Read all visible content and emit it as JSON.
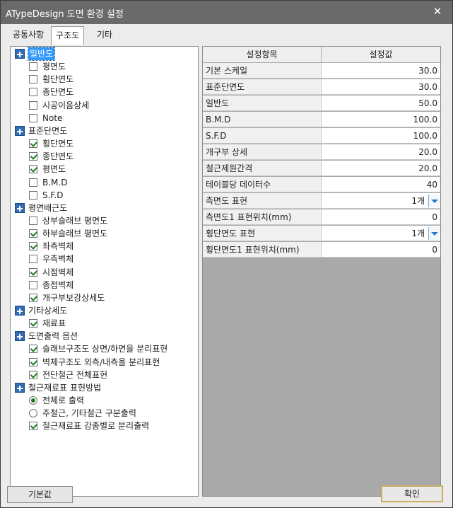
{
  "window": {
    "title": "ATypeDesign 도면 환경 설정",
    "close_label": "✕"
  },
  "tabs": [
    "공통사항",
    "구조도",
    "기타"
  ],
  "tree": [
    {
      "type": "group",
      "label": "일반도",
      "selected": true
    },
    {
      "type": "check",
      "label": "평면도",
      "checked": false
    },
    {
      "type": "check",
      "label": "횡단면도",
      "checked": false
    },
    {
      "type": "check",
      "label": "종단면도",
      "checked": false
    },
    {
      "type": "check",
      "label": "시공이음상세",
      "checked": false
    },
    {
      "type": "check",
      "label": "Note",
      "checked": false
    },
    {
      "type": "group",
      "label": "표준단면도"
    },
    {
      "type": "check",
      "label": "횡단면도",
      "checked": true
    },
    {
      "type": "check",
      "label": "종단면도",
      "checked": true
    },
    {
      "type": "check",
      "label": "평면도",
      "checked": true
    },
    {
      "type": "check",
      "label": "B.M.D",
      "checked": false
    },
    {
      "type": "check",
      "label": "S.F.D",
      "checked": false
    },
    {
      "type": "group",
      "label": "평면배근도"
    },
    {
      "type": "check",
      "label": "상부슬래브 평면도",
      "checked": false
    },
    {
      "type": "check",
      "label": "하부슬래브 평면도",
      "checked": true
    },
    {
      "type": "check",
      "label": "좌측벽체",
      "checked": true
    },
    {
      "type": "check",
      "label": "우측벽체",
      "checked": false
    },
    {
      "type": "check",
      "label": "시점벽체",
      "checked": true
    },
    {
      "type": "check",
      "label": "종점벽체",
      "checked": false
    },
    {
      "type": "check",
      "label": "개구부보강상세도",
      "checked": true
    },
    {
      "type": "group",
      "label": "기타상세도"
    },
    {
      "type": "check",
      "label": "재료표",
      "checked": true
    },
    {
      "type": "group",
      "label": "도면출력 옵션"
    },
    {
      "type": "check",
      "label": "슬래브구조도 상면/하면을 분리표현",
      "checked": true
    },
    {
      "type": "check",
      "label": "벽체구조도 외측/내측을 분리표현",
      "checked": true
    },
    {
      "type": "check",
      "label": "전단철근 전체표현",
      "checked": true
    },
    {
      "type": "group",
      "label": "철근재료표 표현방법"
    },
    {
      "type": "radio",
      "label": "전체로 출력",
      "checked": true
    },
    {
      "type": "radio",
      "label": "주철근, 기타철근 구분출력",
      "checked": false
    },
    {
      "type": "check",
      "label": "철근재료표 강종별로 분리출력",
      "checked": true
    }
  ],
  "grid": {
    "header_name": "설정항목",
    "header_value": "설정값",
    "rows": [
      {
        "name": "기본 스케일",
        "value": "30.0"
      },
      {
        "name": "표준단면도",
        "value": "30.0"
      },
      {
        "name": "일반도",
        "value": "50.0"
      },
      {
        "name": "B.M.D",
        "value": "100.0"
      },
      {
        "name": "S.F.D",
        "value": "100.0"
      },
      {
        "name": "개구부 상세",
        "value": "20.0"
      },
      {
        "name": "철근제원간격",
        "value": "20.0"
      },
      {
        "name": "테이블당 데이터수",
        "value": "40"
      },
      {
        "name": "측면도 표현",
        "value": "1개",
        "combo": true
      },
      {
        "name": "측면도1 표현위치(mm)",
        "value": "0"
      },
      {
        "name": "횡단면도 표현",
        "value": "1개",
        "combo": true
      },
      {
        "name": "횡단면도1 표현위치(mm)",
        "value": "0"
      }
    ]
  },
  "buttons": {
    "default_label": "기본값",
    "ok_label": "확인"
  }
}
